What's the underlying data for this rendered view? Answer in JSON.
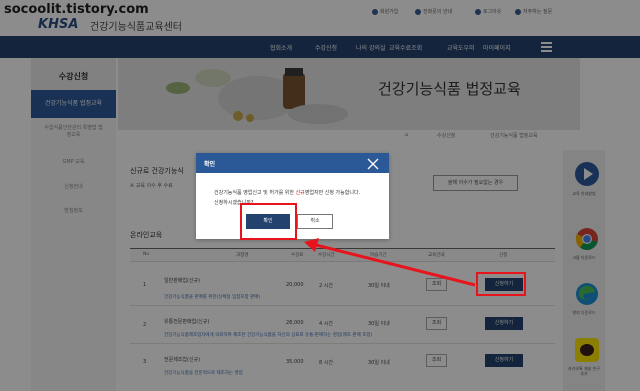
{
  "watermark": "socoolit.tistory.com",
  "header": {
    "logo": "KHSA",
    "org_name": "건강기능식품교육센터",
    "util": [
      "회원가입",
      "전화문의 안내",
      "로그아웃",
      "자주하는 질문"
    ]
  },
  "nav": {
    "items": [
      "협회소개",
      "수강신청",
      "나의 강의실",
      "교육수료조회",
      "교육도우미",
      "마이페이지"
    ]
  },
  "sidebar": {
    "title": "수강신청",
    "active": "건강기능식품 법정교육",
    "items": [
      "수입식품인전관리 특별법 법정교육",
      "GMP 교육",
      "신청안내",
      "방침정보"
    ]
  },
  "hero": {
    "title": "건강기능식품 법정교육"
  },
  "breadcrumb": {
    "items": [
      "수강신청",
      "건강기능식품 법정교육"
    ]
  },
  "intro": {
    "heading": "신규로 건강기능식",
    "note": "※ 교육 이수 후 수료",
    "notice_button": "올해 이수가 필요없는 경우"
  },
  "section": {
    "title": "온라인교육"
  },
  "table": {
    "headers": [
      "No",
      "과정명",
      "수강료",
      "수강시간",
      "학습기간",
      "교육안내",
      "신청"
    ],
    "rows": [
      {
        "no": "1",
        "name": "일반판매업(신규)",
        "desc": "건강기능식품을 판매를 위한(신체등 입점포함 판매)",
        "fee": "20,000",
        "hours": "2 시간",
        "period": "30일 이내",
        "inquiry": "조회",
        "apply": "신청하기"
      },
      {
        "no": "2",
        "name": "유통전문판매업(신규)",
        "desc": "건강기능식품제조업자에게 의뢰하여 제조한 건강기능식품을 자신의 상표로 유통·판매하는 영업(제조 판매 포함)",
        "fee": "28,000",
        "hours": "4 시간",
        "period": "30일 이내",
        "inquiry": "조회",
        "apply": "신청하기"
      },
      {
        "no": "3",
        "name": "전문제조업(신규)",
        "desc": "건강기능식품을 전문적으로 제조하는 영업",
        "fee": "35,000",
        "hours": "8 시간",
        "period": "30일 이내",
        "inquiry": "조회",
        "apply": "신청하기"
      }
    ]
  },
  "browsers": {
    "labels": [
      "교육 안내방법",
      "크롬 다운로드",
      "엣지 다운로드",
      "카카오톡 채널 친구 추가"
    ]
  },
  "modal": {
    "title": "확인",
    "message_before": "건강기능식품 영업신고 및 허가를 위한 ",
    "message_highlight": "신규",
    "message_after": "영업자만 신청 가능합니다.",
    "message_line2": "신청하시겠습니까?",
    "ok_label": "확인",
    "cancel_label": "취소"
  },
  "colors": {
    "nav": "#23426e",
    "primary_button": "#23426e",
    "modal_header": "#2b5897",
    "highlight": "#e8141c",
    "description_link": "#3a6cb3"
  }
}
